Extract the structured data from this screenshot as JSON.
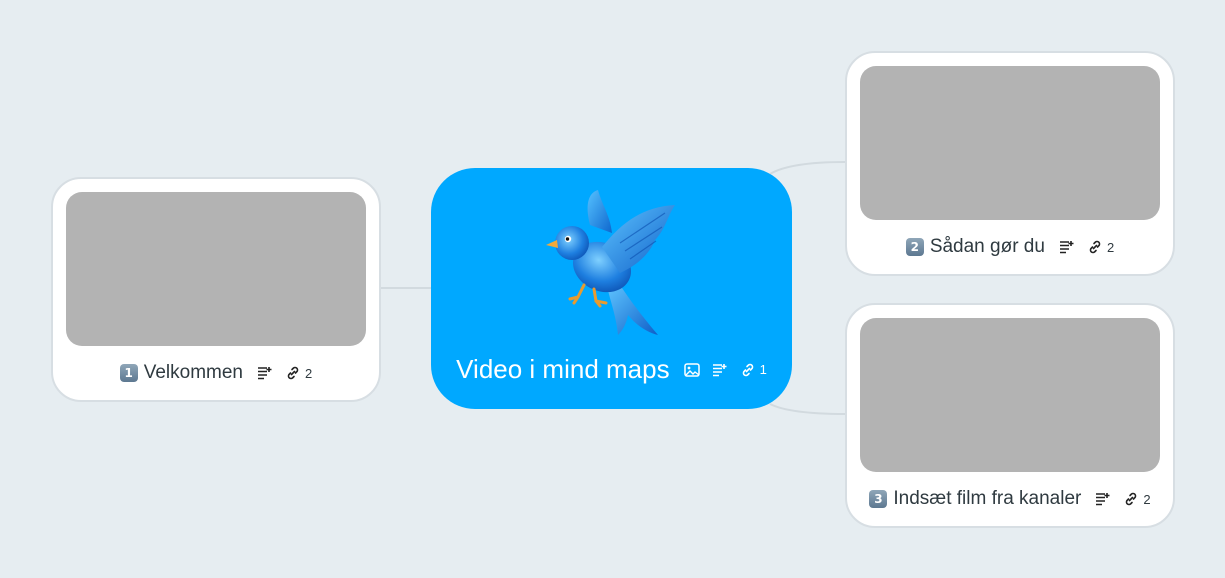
{
  "root": {
    "title": "Video i mind maps",
    "link_count": "1",
    "color": "#00a8ff"
  },
  "topics": [
    {
      "badge": "1",
      "title": "Velkommen",
      "link_count": "2"
    },
    {
      "badge": "2",
      "title": "Sådan gør du",
      "link_count": "2"
    },
    {
      "badge": "3",
      "title": "Indsæt film fra kanaler",
      "link_count": "2"
    }
  ],
  "colors": {
    "background": "#e6edf1",
    "thumbnail": "#b3b3b3",
    "connector": "#d2dadf"
  },
  "icons": [
    "image-icon",
    "notes-icon",
    "link-icon",
    "bird-icon"
  ]
}
